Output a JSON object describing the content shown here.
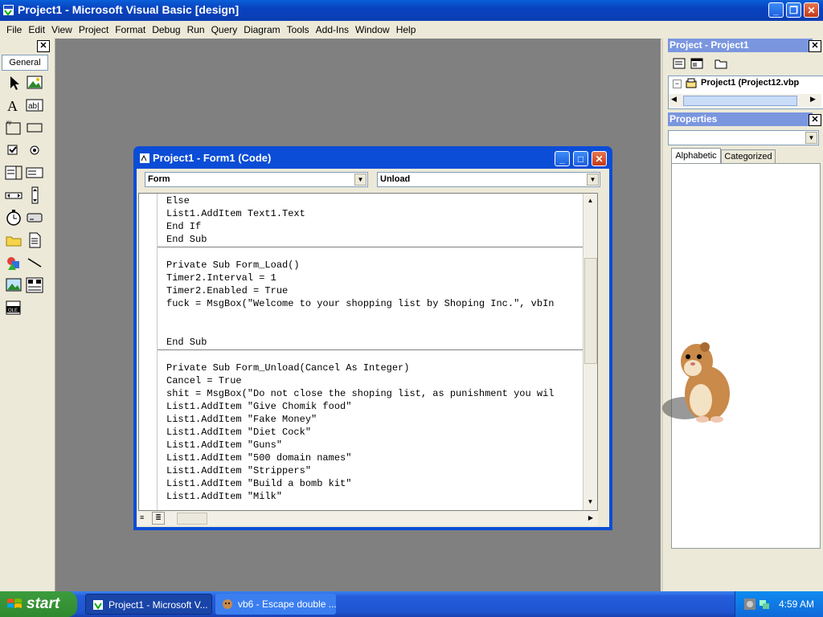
{
  "app": {
    "title": "Project1 - Microsoft Visual Basic [design]"
  },
  "menu": [
    "File",
    "Edit",
    "View",
    "Project",
    "Format",
    "Debug",
    "Run",
    "Query",
    "Diagram",
    "Tools",
    "Add-Ins",
    "Window",
    "Help"
  ],
  "toolbox": {
    "tab_label": "General"
  },
  "project_panel": {
    "title": "Project - Project1",
    "tree_item": "Project1 (Project12.vbp"
  },
  "properties_panel": {
    "title": "Properties",
    "tab_alphabetic": "Alphabetic",
    "tab_categorized": "Categorized"
  },
  "code_window": {
    "title": "Project1 - Form1 (Code)",
    "object_combo": "Form",
    "procedure_combo": "Unload",
    "lines": [
      "Else",
      "List1.AddItem Text1.Text",
      "End If",
      "End Sub",
      "",
      "Private Sub Form_Load()",
      "Timer2.Interval = 1",
      "Timer2.Enabled = True",
      "fuck = MsgBox(\"Welcome to your shopping list by Shoping Inc.\", vbIn",
      "",
      "",
      "End Sub",
      "",
      "Private Sub Form_Unload(Cancel As Integer)",
      "Cancel = True",
      "shit = MsgBox(\"Do not close the shoping list, as punishment you wil",
      "List1.AddItem \"Give Chomik food\"",
      "List1.AddItem \"Fake Money\"",
      "List1.AddItem \"Diet Cock\"",
      "List1.AddItem \"Guns\"",
      "List1.AddItem \"500 domain names\"",
      "List1.AddItem \"Strippers\"",
      "List1.AddItem \"Build a bomb kit\"",
      "List1.AddItem \"Milk\""
    ]
  },
  "taskbar": {
    "start_label": "start",
    "items": [
      "Project1 - Microsoft V...",
      "vb6 - Escape double ..."
    ],
    "clock": "4:59 AM"
  },
  "colors": {
    "titlebar": "#0a5fd8",
    "workspace": "#808080",
    "panel_header": "#7a96df",
    "taskbar": "#245ddb",
    "start_button": "#2f8a2f"
  }
}
